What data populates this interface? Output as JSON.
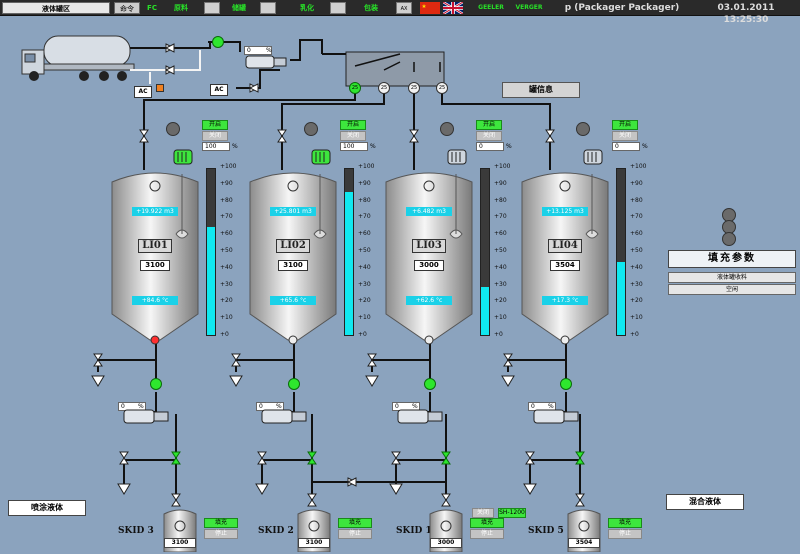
{
  "topbar": {
    "area_label": "液体罐区",
    "cmd_label": "命令",
    "fc": "FC",
    "tabs": [
      "原料",
      "储罐",
      "乳化",
      "包装"
    ],
    "box_label": "AX",
    "status_a": "GEELER",
    "status_b": "VERGER",
    "user": "p (Packager Packager)",
    "datetime": "03.01.2011 13:25:30"
  },
  "tanks": [
    {
      "id": "LI01",
      "num": "3100",
      "read_top": "+19.922 m3",
      "read_bot": "+84.6 °c",
      "level": 65,
      "btn_on": "开启",
      "btn_off": "关闭",
      "pct": "100",
      "unit": "%"
    },
    {
      "id": "LI02",
      "num": "3100",
      "read_top": "+25.801 m3",
      "read_bot": "+65.6 °c",
      "level": 86,
      "btn_on": "开启",
      "btn_off": "关闭",
      "pct": "100",
      "unit": "%"
    },
    {
      "id": "LI03",
      "num": "3000",
      "read_top": "+6.482 m3",
      "read_bot": "+62.6 °c",
      "level": 29,
      "btn_on": "开启",
      "btn_off": "关闭",
      "pct": "0",
      "unit": "%"
    },
    {
      "id": "LI04",
      "num": "3504",
      "read_top": "+13.125 m3",
      "read_bot": "+17.3 °c",
      "level": 44,
      "btn_on": "开启",
      "btn_off": "关闭",
      "pct": "0",
      "unit": "%"
    }
  ],
  "scale_ticks": [
    "+100",
    "+90",
    "+80",
    "+70",
    "+60",
    "+50",
    "+40",
    "+30",
    "+20",
    "+10",
    "+0"
  ],
  "feed_pump": {
    "pct": "0",
    "unit": "%"
  },
  "pump_values": [
    {
      "pct": "0",
      "unit": "%"
    },
    {
      "pct": "0",
      "unit": "%"
    },
    {
      "pct": "0",
      "unit": "%"
    },
    {
      "pct": "0",
      "unit": "%"
    }
  ],
  "ac_label": "AC",
  "manifold_labels": [
    "25",
    "25",
    "25",
    "25"
  ],
  "info_button": "罐信息",
  "fill_panel": {
    "title": "填充参数",
    "row1": "液体罐收料",
    "row2": "空闲"
  },
  "left_label": "喷涂液体",
  "right_label": "混合液体",
  "skids": [
    {
      "name": "SKID 3",
      "num": "3100",
      "btn_on": "填充",
      "btn_off": "停止"
    },
    {
      "name": "SKID 2",
      "num": "3100",
      "btn_on": "填充",
      "btn_off": "停止"
    },
    {
      "name": "SKID 1",
      "num": "3000",
      "btn_on": "填充",
      "btn_off": "停止"
    },
    {
      "name": "SKID 5",
      "num": "3504",
      "btn_on": "填充",
      "btn_off": "停止"
    }
  ],
  "skid1_extra": [
    "关闭",
    "SH-1200"
  ],
  "colors": {
    "background": "#8ba3be",
    "level": "#10e8f0",
    "active": "#3de63d"
  }
}
